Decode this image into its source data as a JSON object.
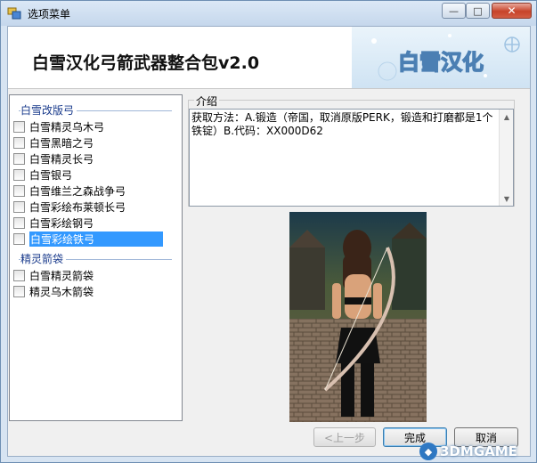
{
  "window": {
    "title": "选项菜单",
    "minimize_glyph": "—",
    "maximize_glyph": "□",
    "close_glyph": "✕"
  },
  "banner": {
    "title": "白雪汉化弓箭武器整合包v2.0",
    "logo_text": "白雪汉化"
  },
  "groups": [
    {
      "header": "白雪改版弓",
      "items": [
        {
          "label": "白雪精灵乌木弓",
          "checked": false
        },
        {
          "label": "白雪黑暗之弓",
          "checked": false
        },
        {
          "label": "白雪精灵长弓",
          "checked": false
        },
        {
          "label": "白雪银弓",
          "checked": false
        },
        {
          "label": "白雪维兰之森战争弓",
          "checked": false
        },
        {
          "label": "白雪彩绘布莱顿长弓",
          "checked": false
        },
        {
          "label": "白雪彩绘钢弓",
          "checked": false
        },
        {
          "label": "白雪彩绘铁弓",
          "checked": false,
          "selected": true
        }
      ]
    },
    {
      "header": "精灵箭袋",
      "items": [
        {
          "label": "白雪精灵箭袋",
          "checked": false
        },
        {
          "label": "精灵乌木箭袋",
          "checked": false
        }
      ]
    }
  ],
  "intro": {
    "legend": "介绍",
    "text": "获取方法：A.锻造（帝国，取消原版PERK，锻造和打磨都是1个铁锭）B.代码：XX000D62"
  },
  "buttons": {
    "prev": "<上一步",
    "finish": "完成",
    "cancel": "取消"
  },
  "watermark": {
    "text": "3DMGAME"
  },
  "colors": {
    "selection": "#3399ff",
    "group_header": "#1a3b8c",
    "close_button": "#c7432a"
  }
}
